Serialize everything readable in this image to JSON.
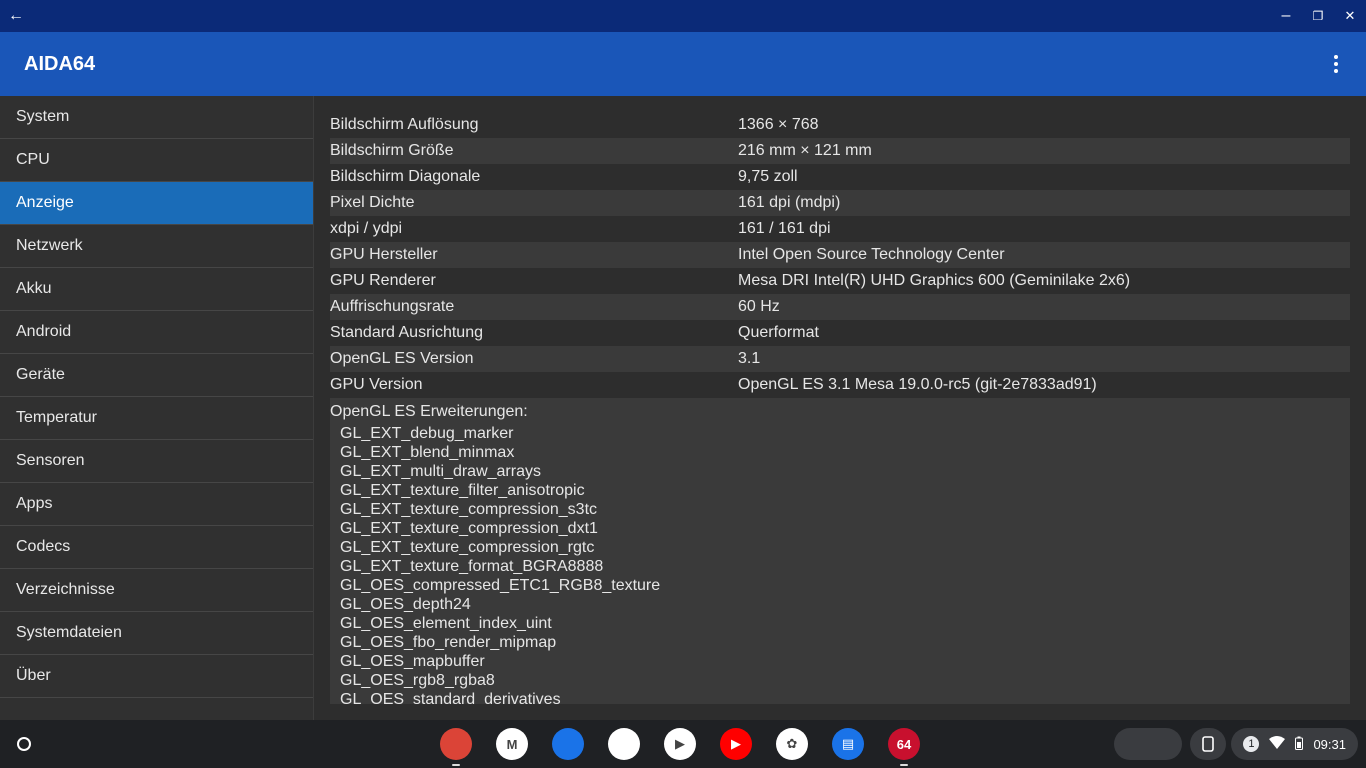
{
  "window": {
    "back_glyph": "←",
    "minimize_glyph": "–",
    "restore_glyph": "❐",
    "close_glyph": "✕"
  },
  "app": {
    "title": "AIDA64"
  },
  "sidebar": {
    "items": [
      {
        "label": "System"
      },
      {
        "label": "CPU"
      },
      {
        "label": "Anzeige"
      },
      {
        "label": "Netzwerk"
      },
      {
        "label": "Akku"
      },
      {
        "label": "Android"
      },
      {
        "label": "Geräte"
      },
      {
        "label": "Temperatur"
      },
      {
        "label": "Sensoren"
      },
      {
        "label": "Apps"
      },
      {
        "label": "Codecs"
      },
      {
        "label": "Verzeichnisse"
      },
      {
        "label": "Systemdateien"
      },
      {
        "label": "Über"
      }
    ],
    "active_index": 2
  },
  "details": {
    "rows": [
      {
        "key": "Bildschirm Auflösung",
        "value": "1366 × 768"
      },
      {
        "key": "Bildschirm Größe",
        "value": "216 mm × 121 mm"
      },
      {
        "key": "Bildschirm Diagonale",
        "value": "9,75 zoll"
      },
      {
        "key": "Pixel Dichte",
        "value": "161 dpi (mdpi)"
      },
      {
        "key": "xdpi / ydpi",
        "value": "161 / 161 dpi"
      },
      {
        "key": "GPU Hersteller",
        "value": "Intel Open Source Technology Center"
      },
      {
        "key": "GPU Renderer",
        "value": "Mesa DRI Intel(R) UHD Graphics 600 (Geminilake 2x6)"
      },
      {
        "key": "Auffrischungsrate",
        "value": "60 Hz"
      },
      {
        "key": "Standard Ausrichtung",
        "value": "Querformat"
      },
      {
        "key": "OpenGL ES Version",
        "value": "3.1"
      },
      {
        "key": "GPU Version",
        "value": "OpenGL ES 3.1 Mesa 19.0.0-rc5 (git-2e7833ad91)"
      }
    ],
    "extensions_heading": "OpenGL ES Erweiterungen:",
    "extensions": [
      "GL_EXT_debug_marker",
      "GL_EXT_blend_minmax",
      "GL_EXT_multi_draw_arrays",
      "GL_EXT_texture_filter_anisotropic",
      "GL_EXT_texture_compression_s3tc",
      "GL_EXT_texture_compression_dxt1",
      "GL_EXT_texture_compression_rgtc",
      "GL_EXT_texture_format_BGRA8888",
      "GL_OES_compressed_ETC1_RGB8_texture",
      "GL_OES_depth24",
      "GL_OES_element_index_uint",
      "GL_OES_fbo_render_mipmap",
      "GL_OES_mapbuffer",
      "GL_OES_rgb8_rgba8",
      "GL_OES_standard_derivatives"
    ]
  },
  "shelf": {
    "apps": [
      {
        "name": "chrome-icon",
        "color": "#db4437",
        "label": ""
      },
      {
        "name": "gmail-icon",
        "color": "#ffffff",
        "label": "M"
      },
      {
        "name": "files-icon",
        "color": "#1a73e8",
        "label": ""
      },
      {
        "name": "meet-icon",
        "color": "#ffffff",
        "label": ""
      },
      {
        "name": "play-store-icon",
        "color": "#ffffff",
        "label": "▶"
      },
      {
        "name": "youtube-icon",
        "color": "#ff0000",
        "label": "▶"
      },
      {
        "name": "photos-icon",
        "color": "#ffffff",
        "label": "✿"
      },
      {
        "name": "messages-icon",
        "color": "#1a73e8",
        "label": "▤"
      },
      {
        "name": "aida64-icon",
        "color": "#c8102e",
        "label": "64"
      }
    ],
    "notification_count": "1",
    "time": "09:31"
  }
}
